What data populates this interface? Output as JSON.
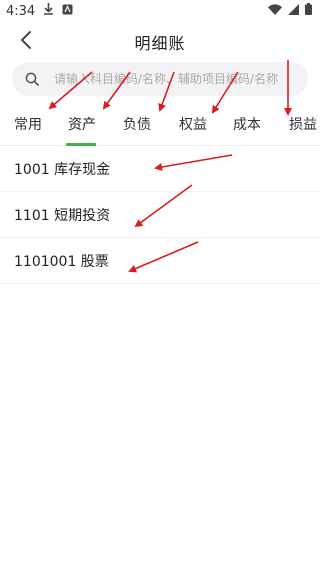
{
  "status": {
    "time": "4:34"
  },
  "header": {
    "title": "明细账"
  },
  "search": {
    "placeholder": "请输入科目编码/名称、辅助项目编码/名称"
  },
  "tabs": [
    {
      "label": "常用",
      "active": false
    },
    {
      "label": "资产",
      "active": true
    },
    {
      "label": "负债",
      "active": false
    },
    {
      "label": "权益",
      "active": false
    },
    {
      "label": "成本",
      "active": false
    },
    {
      "label": "损益",
      "active": false
    }
  ],
  "accounts": [
    {
      "label": "1001 库存现金"
    },
    {
      "label": "1101 短期投资"
    },
    {
      "label": "1101001 股票"
    }
  ],
  "colors": {
    "accent": "#3bb54a",
    "annotation": "#d81e1e"
  }
}
